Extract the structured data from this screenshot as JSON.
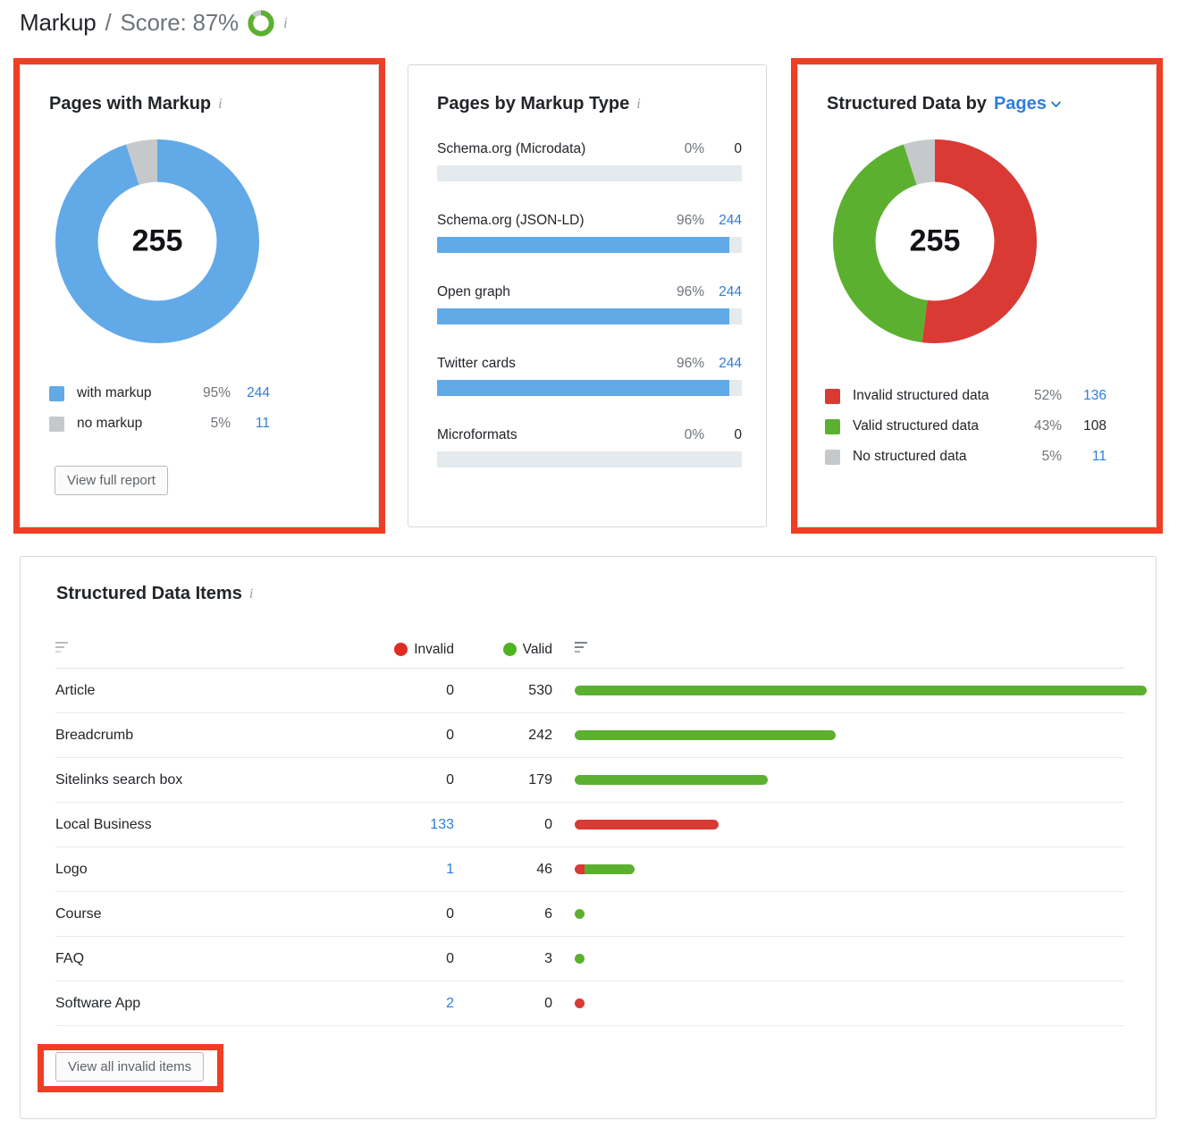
{
  "header": {
    "title": "Markup",
    "separator": "/",
    "score_label": "Score: 87%",
    "score_value": 87,
    "score_color": "#5cb030",
    "info_icon": "info-icon"
  },
  "colors": {
    "blue": "#62a9e8",
    "gray": "#c6c9cb",
    "red": "#d93a34",
    "green": "#5cb030",
    "track": "#e4eaed",
    "link": "#2f7ed8",
    "highlight": "#ef3e23"
  },
  "pages_with_markup": {
    "title": "Pages with Markup",
    "total": "255",
    "legend": [
      {
        "label": "with markup",
        "pct": "95%",
        "value": "244",
        "color": "#62a9e8",
        "value_is_link": true,
        "share": 95
      },
      {
        "label": "no markup",
        "pct": "5%",
        "value": "11",
        "color": "#c6c9cb",
        "value_is_link": true,
        "share": 5
      }
    ],
    "button": "View full report"
  },
  "pages_by_markup_type": {
    "title": "Pages by Markup Type",
    "rows": [
      {
        "name": "Schema.org (Microdata)",
        "pct": "0%",
        "value": "0",
        "fill": 0,
        "value_is_link": false
      },
      {
        "name": "Schema.org (JSON-LD)",
        "pct": "96%",
        "value": "244",
        "fill": 96,
        "value_is_link": true
      },
      {
        "name": "Open graph",
        "pct": "96%",
        "value": "244",
        "fill": 96,
        "value_is_link": true
      },
      {
        "name": "Twitter cards",
        "pct": "96%",
        "value": "244",
        "fill": 96,
        "value_is_link": true
      },
      {
        "name": "Microformats",
        "pct": "0%",
        "value": "0",
        "fill": 0,
        "value_is_link": false
      }
    ]
  },
  "structured_data_by": {
    "title": "Structured Data by",
    "selected": "Pages",
    "total": "255",
    "legend": [
      {
        "label": "Invalid structured data",
        "pct": "52%",
        "value": "136",
        "color": "#d93a34",
        "value_is_link": true,
        "share": 52
      },
      {
        "label": "Valid structured data",
        "pct": "43%",
        "value": "108",
        "color": "#5cb030",
        "value_is_link": false,
        "share": 43
      },
      {
        "label": "No structured data",
        "pct": "5%",
        "value": "11",
        "color": "#c6c9cb",
        "value_is_link": true,
        "share": 5
      }
    ]
  },
  "structured_data_items": {
    "title": "Structured Data Items",
    "columns": {
      "name": "",
      "invalid": "Invalid",
      "valid": "Valid"
    },
    "rows": [
      {
        "name": "Article",
        "invalid": "0",
        "valid": "530",
        "invalid_n": 0,
        "valid_n": 530,
        "invalid_is_link": false,
        "valid_is_link": false
      },
      {
        "name": "Breadcrumb",
        "invalid": "0",
        "valid": "242",
        "invalid_n": 0,
        "valid_n": 242,
        "invalid_is_link": false,
        "valid_is_link": false
      },
      {
        "name": "Sitelinks search box",
        "invalid": "0",
        "valid": "179",
        "invalid_n": 0,
        "valid_n": 179,
        "invalid_is_link": false,
        "valid_is_link": false
      },
      {
        "name": "Local Business",
        "invalid": "133",
        "valid": "0",
        "invalid_n": 133,
        "valid_n": 0,
        "invalid_is_link": true,
        "valid_is_link": false
      },
      {
        "name": "Logo",
        "invalid": "1",
        "valid": "46",
        "invalid_n": 1,
        "valid_n": 46,
        "invalid_is_link": true,
        "valid_is_link": false
      },
      {
        "name": "Course",
        "invalid": "0",
        "valid": "6",
        "invalid_n": 0,
        "valid_n": 6,
        "invalid_is_link": false,
        "valid_is_link": false
      },
      {
        "name": "FAQ",
        "invalid": "0",
        "valid": "3",
        "invalid_n": 0,
        "valid_n": 3,
        "invalid_is_link": false,
        "valid_is_link": false
      },
      {
        "name": "Software App",
        "invalid": "2",
        "valid": "0",
        "invalid_n": 2,
        "valid_n": 0,
        "invalid_is_link": true,
        "valid_is_link": false
      }
    ],
    "max_total": 530,
    "button": "View all invalid items"
  },
  "chart_data": [
    {
      "type": "pie",
      "title": "Pages with Markup",
      "center_label": "255",
      "labels": [
        "with markup",
        "no markup"
      ],
      "values": [
        244,
        11
      ],
      "percents": [
        95,
        5
      ],
      "colors": [
        "#62a9e8",
        "#c6c9cb"
      ],
      "legend": "bottom"
    },
    {
      "type": "bar",
      "title": "Pages by Markup Type",
      "categories": [
        "Schema.org (Microdata)",
        "Schema.org (JSON-LD)",
        "Open graph",
        "Twitter cards",
        "Microformats"
      ],
      "values": [
        0,
        244,
        244,
        244,
        0
      ],
      "percents": [
        0,
        96,
        96,
        96,
        0
      ],
      "xlabel": "",
      "ylabel": "",
      "xlim": [
        0,
        100
      ],
      "grid": false,
      "legend": "none",
      "orientation": "horizontal"
    },
    {
      "type": "pie",
      "title": "Structured Data by Pages",
      "center_label": "255",
      "labels": [
        "Invalid structured data",
        "Valid structured data",
        "No structured data"
      ],
      "values": [
        136,
        108,
        11
      ],
      "percents": [
        52,
        43,
        5
      ],
      "colors": [
        "#d93a34",
        "#5cb030",
        "#c6c9cb"
      ],
      "legend": "bottom"
    },
    {
      "type": "bar",
      "title": "Structured Data Items",
      "categories": [
        "Article",
        "Breadcrumb",
        "Sitelinks search box",
        "Local Business",
        "Logo",
        "Course",
        "FAQ",
        "Software App"
      ],
      "series": [
        {
          "name": "Invalid",
          "values": [
            0,
            0,
            0,
            133,
            1,
            0,
            0,
            2
          ],
          "color": "#d93a34"
        },
        {
          "name": "Valid",
          "values": [
            530,
            242,
            179,
            0,
            46,
            6,
            3,
            0
          ],
          "color": "#5cb030"
        }
      ],
      "xlim": [
        0,
        530
      ],
      "grid": false,
      "legend": "top",
      "orientation": "horizontal",
      "stacked": true
    }
  ]
}
